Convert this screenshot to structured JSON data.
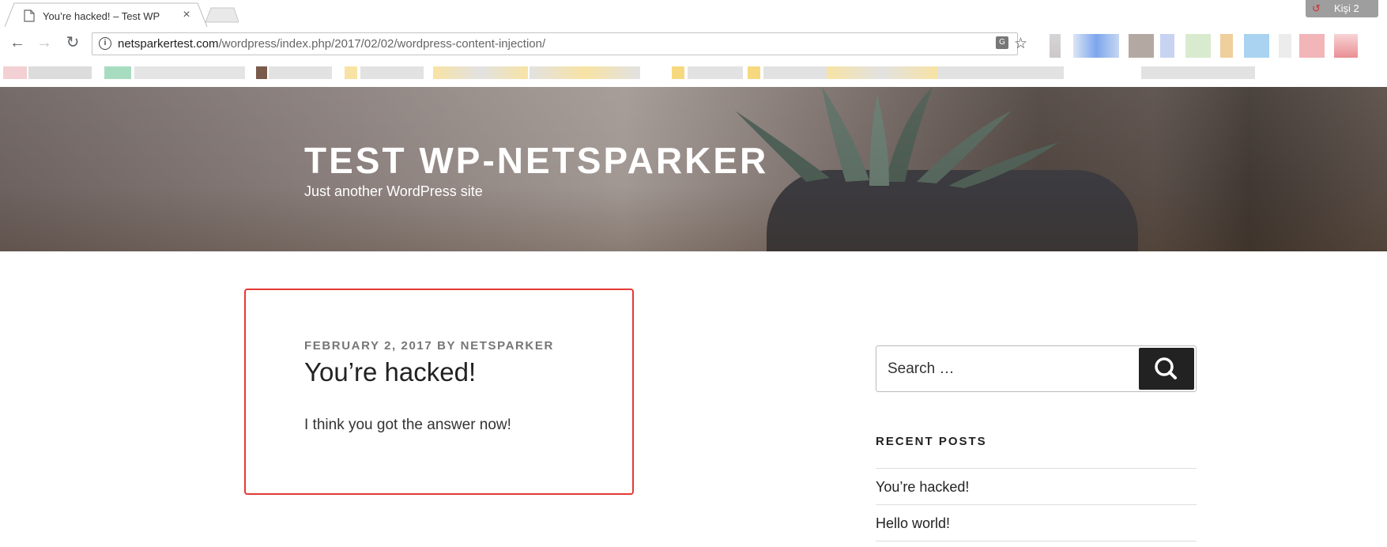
{
  "browser": {
    "tab_title": "You’re hacked! – Test WP",
    "tab_close": "×",
    "profile_label": "Kişi 2",
    "url_host": "netsparkertest.com",
    "url_path": "/wordpress/index.php/2017/02/02/wordpress-content-injection/",
    "nav_back": "←",
    "nav_forward": "→",
    "nav_reload": "↻",
    "star": "☆"
  },
  "site": {
    "title": "TEST WP-NETSPARKER",
    "description": "Just another WordPress site"
  },
  "post": {
    "date": "FEBRUARY 2, 2017",
    "by": "BY",
    "author": "NETSPARKER",
    "title": "You’re hacked!",
    "body": "I think you got the answer now!"
  },
  "sidebar": {
    "search_placeholder": "Search …",
    "recent_posts_title": "RECENT POSTS",
    "recent_posts": [
      "You’re hacked!",
      "Hello world!"
    ]
  },
  "colors": {
    "highlight_border": "#e53935",
    "search_button": "#222222",
    "meta_text": "#767676"
  }
}
